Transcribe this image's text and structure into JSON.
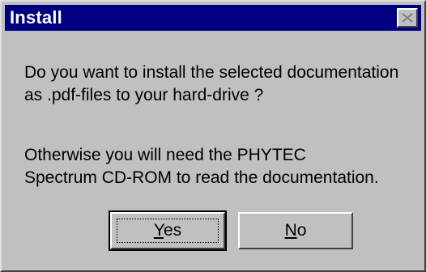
{
  "window": {
    "title": "Install"
  },
  "message": {
    "line1": "Do you want to install the selected documentation",
    "line2": "as .pdf-files to your hard-drive ?",
    "line3": "Otherwise you will need the PHYTEC",
    "line4": "Spectrum CD-ROM to read the documentation."
  },
  "buttons": {
    "yes": {
      "accel": "Y",
      "rest": "es"
    },
    "no": {
      "accel": "N",
      "rest": "o"
    }
  },
  "icons": {
    "close": "close-icon"
  },
  "colors": {
    "titlebar": "#000080",
    "dialog_bg": "#c0c0c0"
  }
}
